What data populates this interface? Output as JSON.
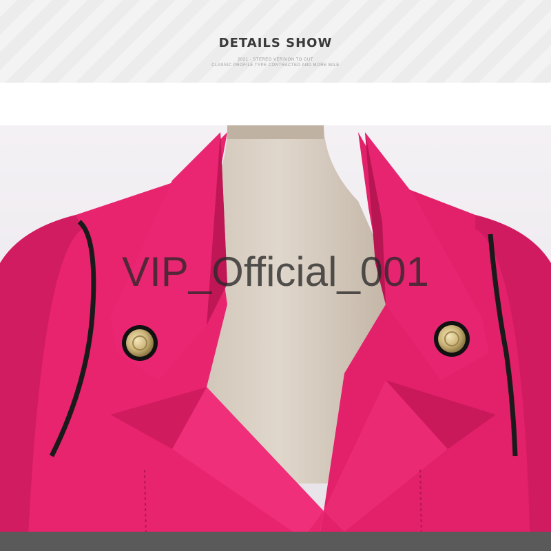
{
  "header": {
    "title": "DETAILS SHOW",
    "subtitle_line1": "2021 · STEREO VERSION TO CUT",
    "subtitle_line2": "CLASSIC PROFILE TYPE CONTRACTED AND MORE MILE"
  },
  "photo": {
    "subject": "pink-blazer-collar-on-mannequin",
    "colors": {
      "jacket": "#e8246e",
      "jacket_shadow": "#b81553",
      "piping": "#1a1a1a",
      "mannequin": "#d9cfc2",
      "backdrop": "#eeeaf0",
      "button_gold": "#d8c38a",
      "floor_band": "#5a5a5a"
    }
  },
  "watermark": {
    "text": "VIP_Official_001"
  }
}
